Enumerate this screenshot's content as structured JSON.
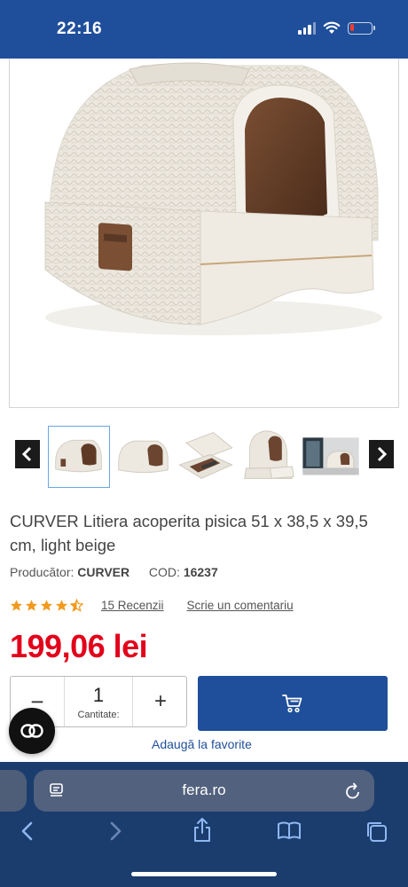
{
  "status_bar": {
    "time": "22:16",
    "signal_icon": "cellular-signal-icon",
    "wifi_icon": "wifi-icon",
    "battery_icon": "battery-low-icon",
    "battery_level": 0.2,
    "background_color": "#1f4f9b"
  },
  "product": {
    "main_image": "covered-cat-litter-box-image",
    "thumbnails": [
      {
        "name": "litter-box-front-thumb",
        "active": true
      },
      {
        "name": "litter-box-side-thumb",
        "active": false
      },
      {
        "name": "litter-box-open-drawer-thumb",
        "active": false
      },
      {
        "name": "litter-box-lid-open-thumb",
        "active": false
      },
      {
        "name": "litter-box-room-photo-thumb",
        "active": false
      }
    ],
    "title": "CURVER Litiera acoperita pisica 51 x 38,5 x 39,5 cm, light beige",
    "producer_label": "Producător:",
    "producer": "CURVER",
    "code_label": "COD:",
    "code": "16237",
    "rating": 4.5,
    "reviews_link": "15 Recenzii",
    "write_comment_link": "Scrie un comentariu",
    "price": "199,06 lei",
    "price_color": "#e3001b"
  },
  "purchase": {
    "minus": "−",
    "plus": "+",
    "quantity": "1",
    "quantity_label": "Cantitate:",
    "cart_icon": "shopping-cart-icon",
    "cart_button_color": "#1f4f9b",
    "add_to_favorites": "Adaugă la favorite"
  },
  "safari": {
    "url": "fera.ro",
    "left_icon": "page-menu-icon",
    "reload_icon": "reload-icon",
    "nav": [
      "back-icon",
      "forward-icon",
      "share-icon",
      "bookmarks-icon",
      "tabs-icon"
    ]
  }
}
